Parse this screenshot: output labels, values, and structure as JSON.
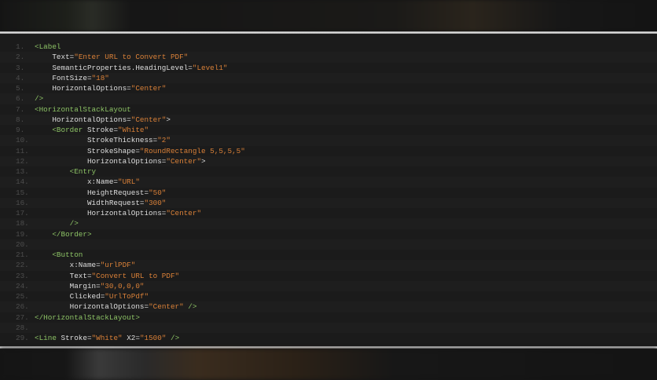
{
  "editor": {
    "lines": [
      [
        [
          "tag",
          "<Label"
        ]
      ],
      [
        [
          "plain",
          "    "
        ],
        [
          "attr",
          "Text="
        ],
        [
          "str",
          "\"Enter URL to Convert PDF\""
        ]
      ],
      [
        [
          "plain",
          "    "
        ],
        [
          "attr",
          "SemanticProperties.HeadingLevel="
        ],
        [
          "str",
          "\"Level1\""
        ]
      ],
      [
        [
          "plain",
          "    "
        ],
        [
          "attr",
          "FontSize="
        ],
        [
          "str",
          "\"18\""
        ]
      ],
      [
        [
          "plain",
          "    "
        ],
        [
          "attr",
          "HorizontalOptions="
        ],
        [
          "str",
          "\"Center\""
        ]
      ],
      [
        [
          "tag",
          "/>"
        ]
      ],
      [
        [
          "tag",
          "<HorizontalStackLayout"
        ]
      ],
      [
        [
          "plain",
          "    "
        ],
        [
          "attr",
          "HorizontalOptions="
        ],
        [
          "str",
          "\"Center\""
        ],
        [
          "attr",
          ">"
        ]
      ],
      [
        [
          "plain",
          "    "
        ],
        [
          "tag",
          "<Border"
        ],
        [
          "attr",
          " Stroke="
        ],
        [
          "str",
          "\"White\""
        ]
      ],
      [
        [
          "plain",
          "            "
        ],
        [
          "attr",
          "StrokeThickness="
        ],
        [
          "str",
          "\"2\""
        ]
      ],
      [
        [
          "plain",
          "            "
        ],
        [
          "attr",
          "StrokeShape="
        ],
        [
          "str",
          "\"RoundRectangle 5,5,5,5\""
        ]
      ],
      [
        [
          "plain",
          "            "
        ],
        [
          "attr",
          "HorizontalOptions="
        ],
        [
          "str",
          "\"Center\""
        ],
        [
          "attr",
          ">"
        ]
      ],
      [
        [
          "plain",
          "        "
        ],
        [
          "tag",
          "<Entry"
        ]
      ],
      [
        [
          "plain",
          "            "
        ],
        [
          "attr",
          "x:Name="
        ],
        [
          "str",
          "\"URL\""
        ]
      ],
      [
        [
          "plain",
          "            "
        ],
        [
          "attr",
          "HeightRequest="
        ],
        [
          "str",
          "\"50\""
        ]
      ],
      [
        [
          "plain",
          "            "
        ],
        [
          "attr",
          "WidthRequest="
        ],
        [
          "str",
          "\"300\""
        ]
      ],
      [
        [
          "plain",
          "            "
        ],
        [
          "attr",
          "HorizontalOptions="
        ],
        [
          "str",
          "\"Center\""
        ]
      ],
      [
        [
          "plain",
          "        "
        ],
        [
          "tag",
          "/>"
        ]
      ],
      [
        [
          "plain",
          "    "
        ],
        [
          "tag",
          "</Border>"
        ]
      ],
      [],
      [
        [
          "plain",
          "    "
        ],
        [
          "tag",
          "<Button"
        ]
      ],
      [
        [
          "plain",
          "        "
        ],
        [
          "attr",
          "x:Name="
        ],
        [
          "str",
          "\"urlPDF\""
        ]
      ],
      [
        [
          "plain",
          "        "
        ],
        [
          "attr",
          "Text="
        ],
        [
          "str",
          "\"Convert URL to PDF\""
        ]
      ],
      [
        [
          "plain",
          "        "
        ],
        [
          "attr",
          "Margin="
        ],
        [
          "str",
          "\"30,0,0,0\""
        ]
      ],
      [
        [
          "plain",
          "        "
        ],
        [
          "attr",
          "Clicked="
        ],
        [
          "str",
          "\"UrlToPdf\""
        ]
      ],
      [
        [
          "plain",
          "        "
        ],
        [
          "attr",
          "HorizontalOptions="
        ],
        [
          "str",
          "\"Center\""
        ],
        [
          "tag",
          " />"
        ]
      ],
      [
        [
          "tag",
          "</HorizontalStackLayout>"
        ]
      ],
      [],
      [
        [
          "tag",
          "<Line"
        ],
        [
          "attr",
          " Stroke="
        ],
        [
          "str",
          "\"White\""
        ],
        [
          "attr",
          " X2="
        ],
        [
          "str",
          "\"1500\""
        ],
        [
          "tag",
          " />"
        ]
      ]
    ],
    "line_numbers": [
      "1.",
      "2.",
      "3.",
      "4.",
      "5.",
      "6.",
      "7.",
      "8.",
      "9.",
      "10.",
      "11.",
      "12.",
      "13.",
      "14.",
      "15.",
      "16.",
      "17.",
      "18.",
      "19.",
      "20.",
      "21.",
      "22.",
      "23.",
      "24.",
      "25.",
      "26.",
      "27.",
      "28.",
      "29."
    ]
  }
}
